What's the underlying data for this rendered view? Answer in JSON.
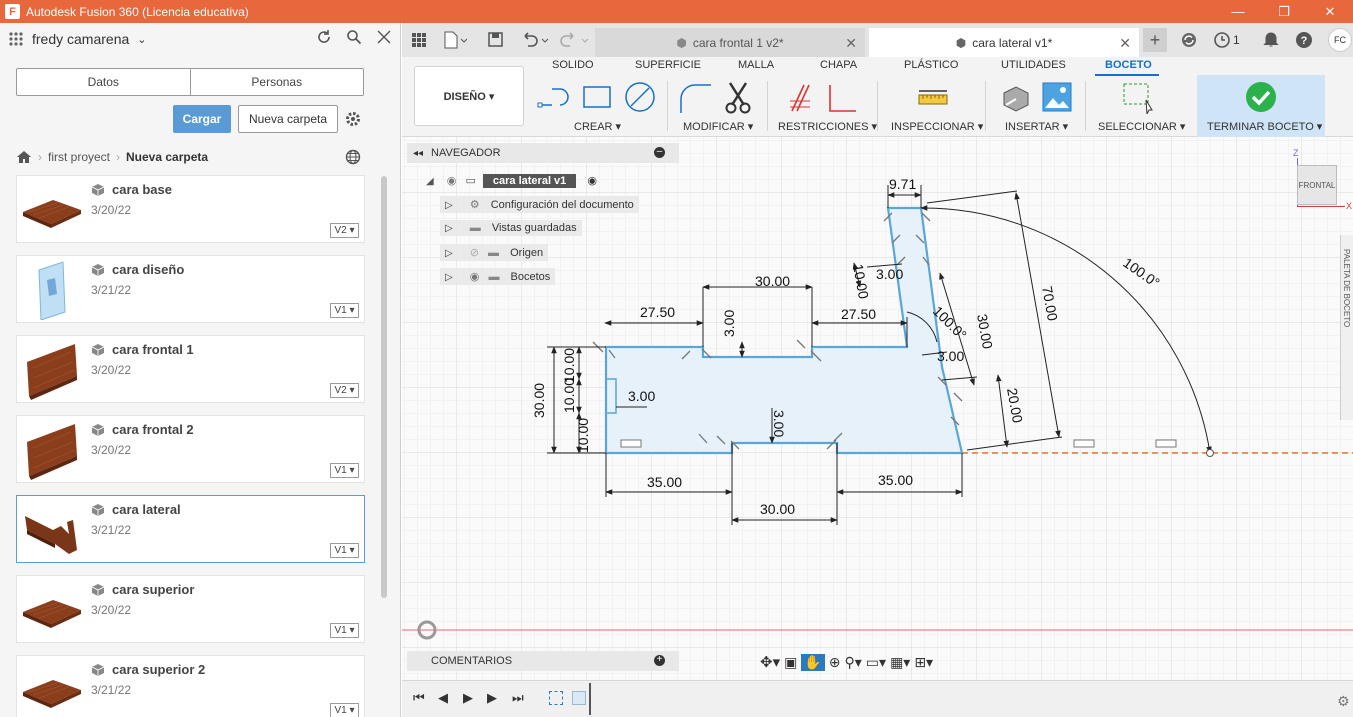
{
  "window": {
    "title": "Autodesk Fusion 360 (Licencia educativa)",
    "app_logo": "F",
    "controls": [
      "minimize-icon",
      "restore-icon",
      "close-icon"
    ]
  },
  "left_panel": {
    "user_name": "fredy camarena",
    "tabs": {
      "datos": "Datos",
      "personas": "Personas"
    },
    "buttons": {
      "cargar": "Cargar",
      "nueva_carpeta": "Nueva carpeta"
    },
    "breadcrumb": {
      "project": "first proyect",
      "folder": "Nueva carpeta"
    },
    "files": [
      {
        "name": "cara base",
        "date": "3/20/22",
        "version": "V2 ▾",
        "thumb": "board"
      },
      {
        "name": "cara diseño",
        "date": "3/21/22",
        "version": "V1 ▾",
        "thumb": "glass"
      },
      {
        "name": "cara frontal 1",
        "date": "3/20/22",
        "version": "V2 ▾",
        "thumb": "plank"
      },
      {
        "name": "cara frontal 2",
        "date": "3/20/22",
        "version": "V1 ▾",
        "thumb": "plank"
      },
      {
        "name": "cara lateral",
        "date": "3/21/22",
        "version": "V1 ▾",
        "thumb": "side"
      },
      {
        "name": "cara superior",
        "date": "3/20/22",
        "version": "V1 ▾",
        "thumb": "board"
      },
      {
        "name": "cara superior 2",
        "date": "3/21/22",
        "version": "V1 ▾",
        "thumb": "board"
      }
    ]
  },
  "doc_tabs": [
    {
      "label": "cara frontal 1 v2*"
    },
    {
      "label": "cara lateral v1*"
    }
  ],
  "qat": {
    "notifications": "1",
    "user_initials": "FC"
  },
  "ribbon": {
    "workspace": "DISEÑO ▾",
    "tabs": [
      "SOLIDO",
      "SUPERFICIE",
      "MALLA",
      "CHAPA",
      "PLÁSTICO",
      "UTILIDADES",
      "BOCETO"
    ],
    "groups": [
      "CREAR ▾",
      "MODIFICAR ▾",
      "RESTRICCIONES ▾",
      "INSPECCIONAR ▾",
      "INSERTAR ▾",
      "SELECCIONAR ▾",
      "TERMINAR BOCETO ▾"
    ]
  },
  "navigator": {
    "header": "NAVEGADOR",
    "root": "cara lateral v1",
    "items": [
      "Configuración del documento",
      "Vistas guardadas",
      "Origen",
      "Bocetos"
    ]
  },
  "comments": "COMENTARIOS",
  "viewcube": {
    "face": "FRONTAL",
    "z": "Z",
    "x": "X"
  },
  "palette": "PALETA DE BOCETO",
  "dimensions": {
    "d1": "9.71",
    "d2": "100.0°",
    "d3": "70.00",
    "d4": "30.00",
    "d5": "27.50",
    "d6": "27.50",
    "d7": "3.00",
    "d8": "10.00",
    "d9": "3.00",
    "d10": "100.0°",
    "d11": "30.00",
    "d12": "3.00",
    "d13": "20.00",
    "d14": "30.00",
    "d15": "10.00",
    "d16": "10.00",
    "d17": "10.00",
    "d18": "3.00",
    "d19": "3.00",
    "d20": "35.00",
    "d21": "35.00",
    "d22": "30.00"
  },
  "colors": {
    "titlebar": "#e8673d",
    "accent": "#1770c6",
    "sketch": "#5aa6d6",
    "fill": "#e6f1fa"
  }
}
